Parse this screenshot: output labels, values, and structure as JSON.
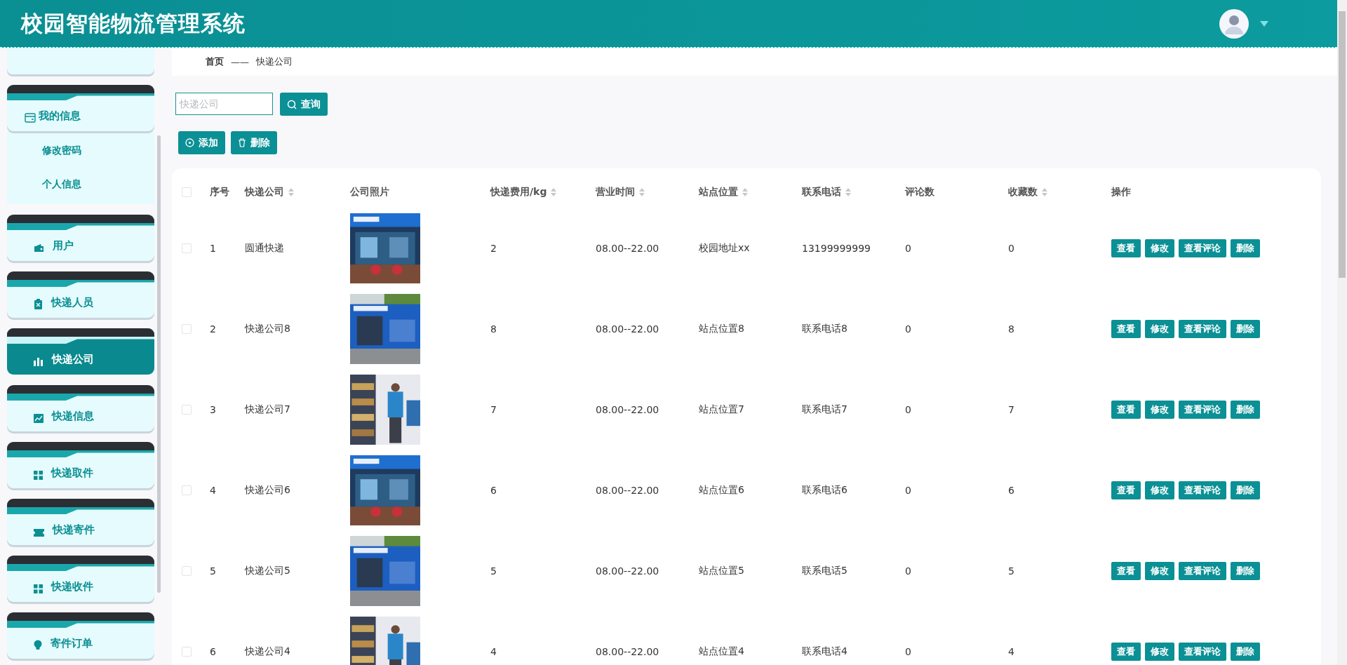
{
  "header": {
    "title": "校园智能物流管理系统"
  },
  "sidebar": {
    "items": [
      {
        "label": "我的信息",
        "selected": false,
        "expanded": true,
        "children": [
          {
            "label": "修改密码"
          },
          {
            "label": "个人信息"
          }
        ]
      },
      {
        "label": "用户",
        "selected": false,
        "expanded": false
      },
      {
        "label": "快递人员",
        "selected": false,
        "expanded": false
      },
      {
        "label": "快递公司",
        "selected": true,
        "expanded": false
      },
      {
        "label": "快递信息",
        "selected": false,
        "expanded": false
      },
      {
        "label": "快递取件",
        "selected": false,
        "expanded": false
      },
      {
        "label": "快递寄件",
        "selected": false,
        "expanded": false
      },
      {
        "label": "快递收件",
        "selected": false,
        "expanded": false
      },
      {
        "label": "寄件订单",
        "selected": false,
        "expanded": false
      }
    ]
  },
  "breadcrumb": [
    "首页",
    "——",
    "快递公司"
  ],
  "search": {
    "placeholder": "快递公司",
    "button": "查询"
  },
  "toolbar": [
    "添加",
    "删除"
  ],
  "table": {
    "select_all": {
      "checked": false
    },
    "columns": [
      {
        "label": "序号",
        "sortable": false
      },
      {
        "label": "快递公司",
        "sortable": true
      },
      {
        "label": "公司照片",
        "sortable": false
      },
      {
        "label": "快递费用/kg",
        "sortable": true
      },
      {
        "label": "营业时间",
        "sortable": true
      },
      {
        "label": "站点位置",
        "sortable": true
      },
      {
        "label": "联系电话",
        "sortable": true
      },
      {
        "label": "评论数",
        "sortable": false
      },
      {
        "label": "收藏数",
        "sortable": true
      },
      {
        "label": "操作",
        "sortable": false
      }
    ],
    "rows": [
      {
        "checked": false,
        "cells": [
          "1",
          "圆通快递",
          {
            "kind": "picture"
          },
          "2",
          "08.00--22.00",
          "校园地址xx",
          "13199999999",
          "0",
          "0"
        ],
        "actions": [
          "查看",
          "修改",
          "查看评论",
          "删除"
        ]
      },
      {
        "checked": false,
        "cells": [
          "2",
          "快递公司8",
          {
            "kind": "picture"
          },
          "8",
          "08.00--22.00",
          "站点位置8",
          "联系电话8",
          "0",
          "8"
        ],
        "actions": [
          "查看",
          "修改",
          "查看评论",
          "删除"
        ]
      },
      {
        "checked": false,
        "cells": [
          "3",
          "快递公司7",
          {
            "kind": "picture"
          },
          "7",
          "08.00--22.00",
          "站点位置7",
          "联系电话7",
          "0",
          "7"
        ],
        "actions": [
          "查看",
          "修改",
          "查看评论",
          "删除"
        ]
      },
      {
        "checked": false,
        "cells": [
          "4",
          "快递公司6",
          {
            "kind": "picture"
          },
          "6",
          "08.00--22.00",
          "站点位置6",
          "联系电话6",
          "0",
          "6"
        ],
        "actions": [
          "查看",
          "修改",
          "查看评论",
          "删除"
        ]
      },
      {
        "checked": false,
        "cells": [
          "5",
          "快递公司5",
          {
            "kind": "picture"
          },
          "5",
          "08.00--22.00",
          "站点位置5",
          "联系电话5",
          "0",
          "5"
        ],
        "actions": [
          "查看",
          "修改",
          "查看评论",
          "删除"
        ]
      },
      {
        "checked": false,
        "cells": [
          "6",
          "快递公司4",
          {
            "kind": "picture"
          },
          "4",
          "08.00--22.00",
          "站点位置4",
          "联系电话4",
          "0",
          "4"
        ],
        "actions": [
          "查看",
          "修改",
          "查看评论",
          "删除"
        ]
      }
    ]
  }
}
